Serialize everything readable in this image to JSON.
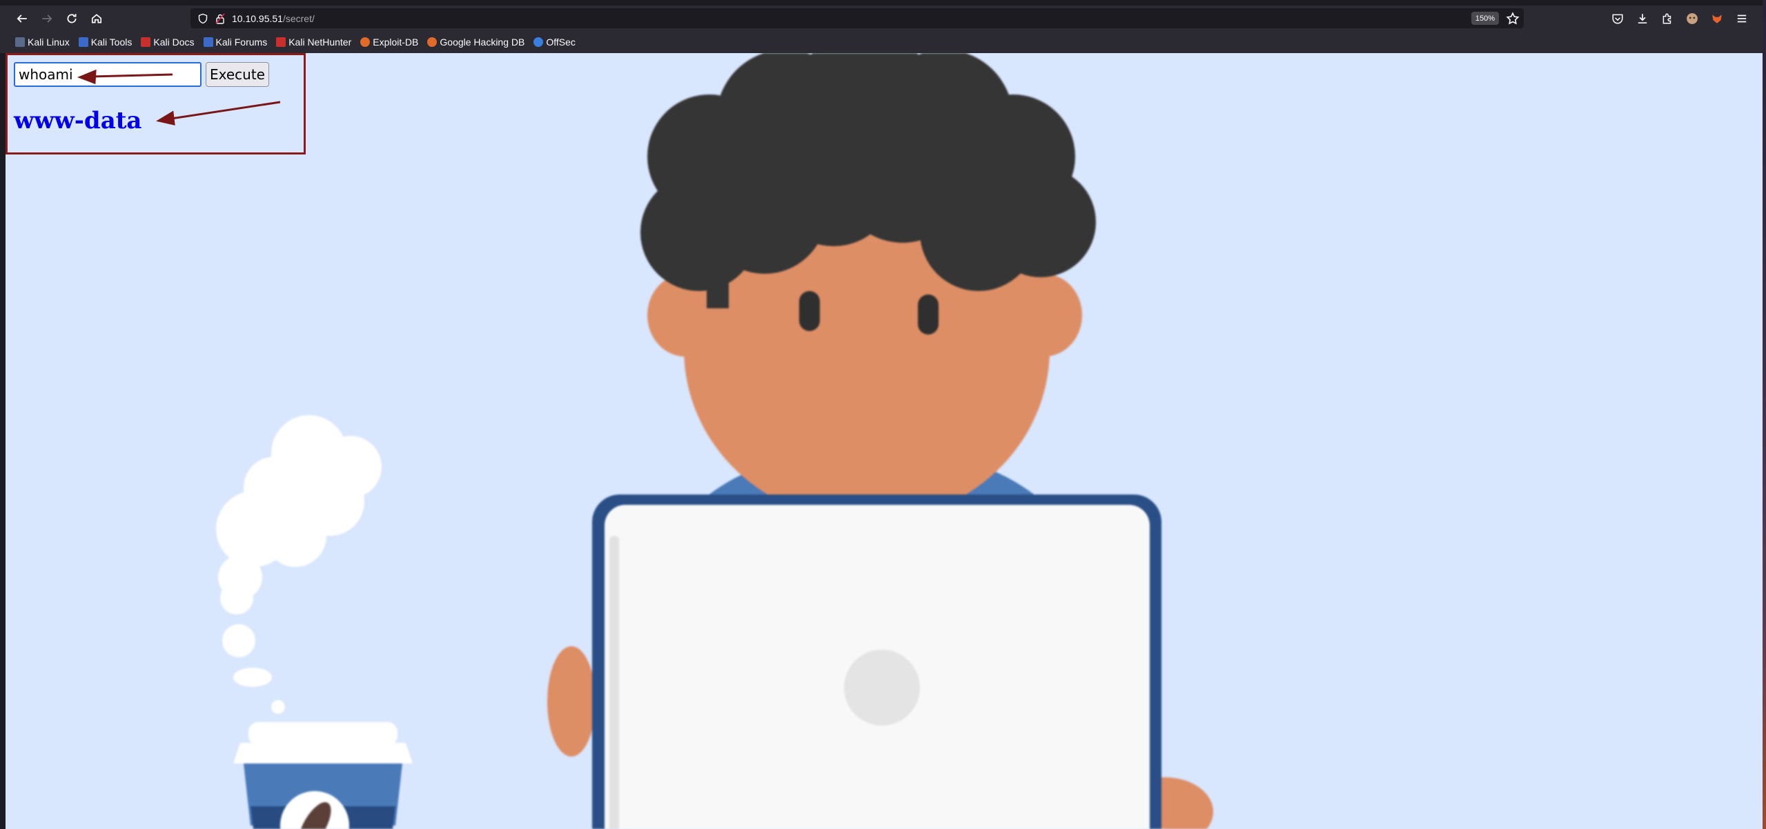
{
  "browser": {
    "url_host": "10.10.95.51",
    "url_path": "/secret/",
    "zoom": "150%",
    "bookmarks": [
      {
        "label": "Kali Linux",
        "color": "#5a6a8a"
      },
      {
        "label": "Kali Tools",
        "color": "#3a6bc8"
      },
      {
        "label": "Kali Docs",
        "color": "#c8302c"
      },
      {
        "label": "Kali Forums",
        "color": "#3a6bc8"
      },
      {
        "label": "Kali NetHunter",
        "color": "#c8302c"
      },
      {
        "label": "Exploit-DB",
        "color": "#e06a2a"
      },
      {
        "label": "Google Hacking DB",
        "color": "#e06a2a"
      },
      {
        "label": "OffSec",
        "color": "#3a7fe0"
      }
    ]
  },
  "form": {
    "command_value": "whoami",
    "execute_label": "Execute"
  },
  "result": {
    "output": "www-data"
  },
  "colors": {
    "page_bg": "#d8e6fe",
    "annotation": "#8b1a1a",
    "output_text": "#0000ee"
  }
}
